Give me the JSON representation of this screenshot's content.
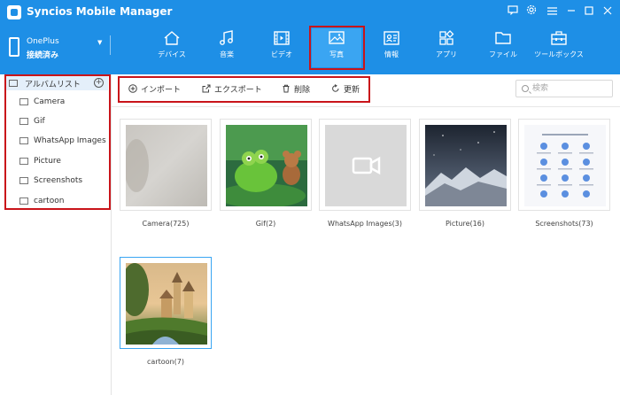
{
  "app": {
    "title": "Syncios Mobile Manager",
    "accent": "#1e8fe6",
    "highlight": "#c9141a"
  },
  "device": {
    "name": "OnePlus",
    "status": "接続済み"
  },
  "nav": {
    "tabs": [
      {
        "label": "デバイス",
        "icon": "home-icon"
      },
      {
        "label": "音楽",
        "icon": "music-icon"
      },
      {
        "label": "ビデオ",
        "icon": "film-icon"
      },
      {
        "label": "写真",
        "icon": "photo-icon",
        "active": true
      },
      {
        "label": "情報",
        "icon": "contact-card-icon"
      },
      {
        "label": "アプリ",
        "icon": "apps-icon"
      },
      {
        "label": "ファイル",
        "icon": "folder-icon"
      },
      {
        "label": "ツールボックス",
        "icon": "toolbox-icon"
      }
    ]
  },
  "sidebar": {
    "header": "アルバムリスト",
    "items": [
      {
        "label": "Camera"
      },
      {
        "label": "Gif"
      },
      {
        "label": "WhatsApp Images"
      },
      {
        "label": "Picture"
      },
      {
        "label": "Screenshots"
      },
      {
        "label": "cartoon"
      }
    ]
  },
  "toolbar": {
    "import_label": "インポート",
    "export_label": "エクスポート",
    "delete_label": "削除",
    "refresh_label": "更新"
  },
  "search": {
    "placeholder": "検索"
  },
  "albums": [
    {
      "caption": "Camera(725)"
    },
    {
      "caption": "Gif(2)"
    },
    {
      "caption": "WhatsApp Images(3)"
    },
    {
      "caption": "Picture(16)"
    },
    {
      "caption": "Screenshots(73)"
    },
    {
      "caption": "cartoon(7)",
      "selected": true
    }
  ]
}
